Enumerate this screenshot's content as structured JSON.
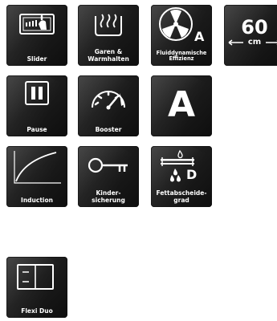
{
  "tiles": {
    "slider": {
      "label": "Slider"
    },
    "garen": {
      "label": "Garen &\nWarmhalten"
    },
    "fluid": {
      "label": "Fluiddynamische\nEffizienz",
      "badge": "A"
    },
    "width": {
      "value": "60",
      "unit": "cm"
    },
    "pause": {
      "label": "Pause"
    },
    "booster": {
      "label": "Booster"
    },
    "energy": {
      "letter": "A"
    },
    "induction": {
      "label": "Induction"
    },
    "kinder": {
      "label": "Kinder-\nsicherung"
    },
    "fett": {
      "label": "Fettabscheide-\ngrad",
      "grade": "D"
    },
    "flexi": {
      "label": "Flexi Duo"
    }
  },
  "colors": {
    "tile_bg": "#1c1c1c",
    "icon": "#ffffff"
  }
}
